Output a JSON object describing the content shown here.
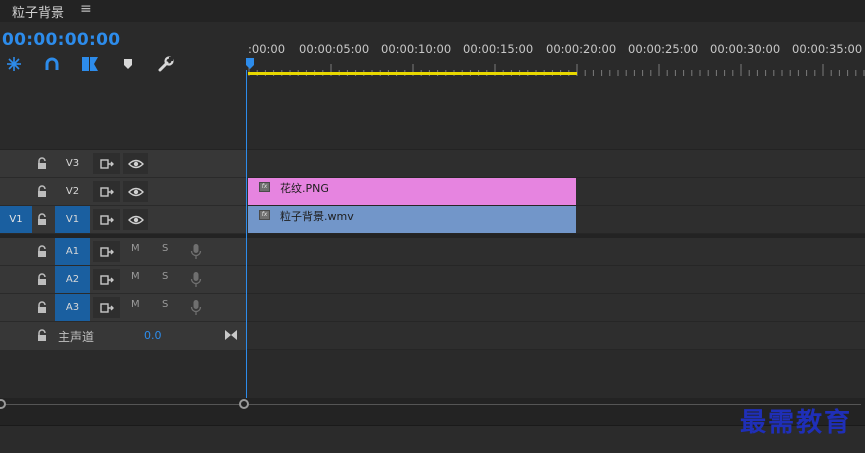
{
  "panel": {
    "title": "粒子背景",
    "menu_icon": "hamburger-icon"
  },
  "timecode": "00:00:00:00",
  "toolbar": [
    {
      "name": "snap-icon"
    },
    {
      "name": "linked-selection-icon"
    },
    {
      "name": "add-marker-icon"
    },
    {
      "name": "marker-icon"
    },
    {
      "name": "wrench-icon"
    }
  ],
  "ruler": {
    "labels": [
      ":00:00",
      "00:00:05:00",
      "00:00:10:00",
      "00:00:15:00",
      "00:00:20:00",
      "00:00:25:00",
      "00:00:30:00",
      "00:00:35:00"
    ]
  },
  "video_tracks": [
    {
      "label": "V3",
      "source": "",
      "targeted": false
    },
    {
      "label": "V2",
      "source": "",
      "targeted": false
    },
    {
      "label": "V1",
      "source": "V1",
      "targeted": true
    }
  ],
  "audio_tracks": [
    {
      "label": "A1",
      "mute": "M",
      "solo": "S",
      "targeted": true
    },
    {
      "label": "A2",
      "mute": "M",
      "solo": "S",
      "targeted": true
    },
    {
      "label": "A3",
      "mute": "M",
      "solo": "S",
      "targeted": true
    }
  ],
  "master": {
    "label": "主声道",
    "value": "0.0"
  },
  "clips": [
    {
      "track": "V2",
      "name": "花纹.PNG",
      "fx": "fx"
    },
    {
      "track": "V1",
      "name": "粒子背景.wmv",
      "fx": "fx"
    }
  ],
  "watermark": "最需教育",
  "colors": {
    "accent": "#2d8ceb",
    "clip_graphic": "#e684e0",
    "clip_video": "#7296c9",
    "work_area": "#e8d800",
    "target_blue": "#1a5fa0"
  }
}
